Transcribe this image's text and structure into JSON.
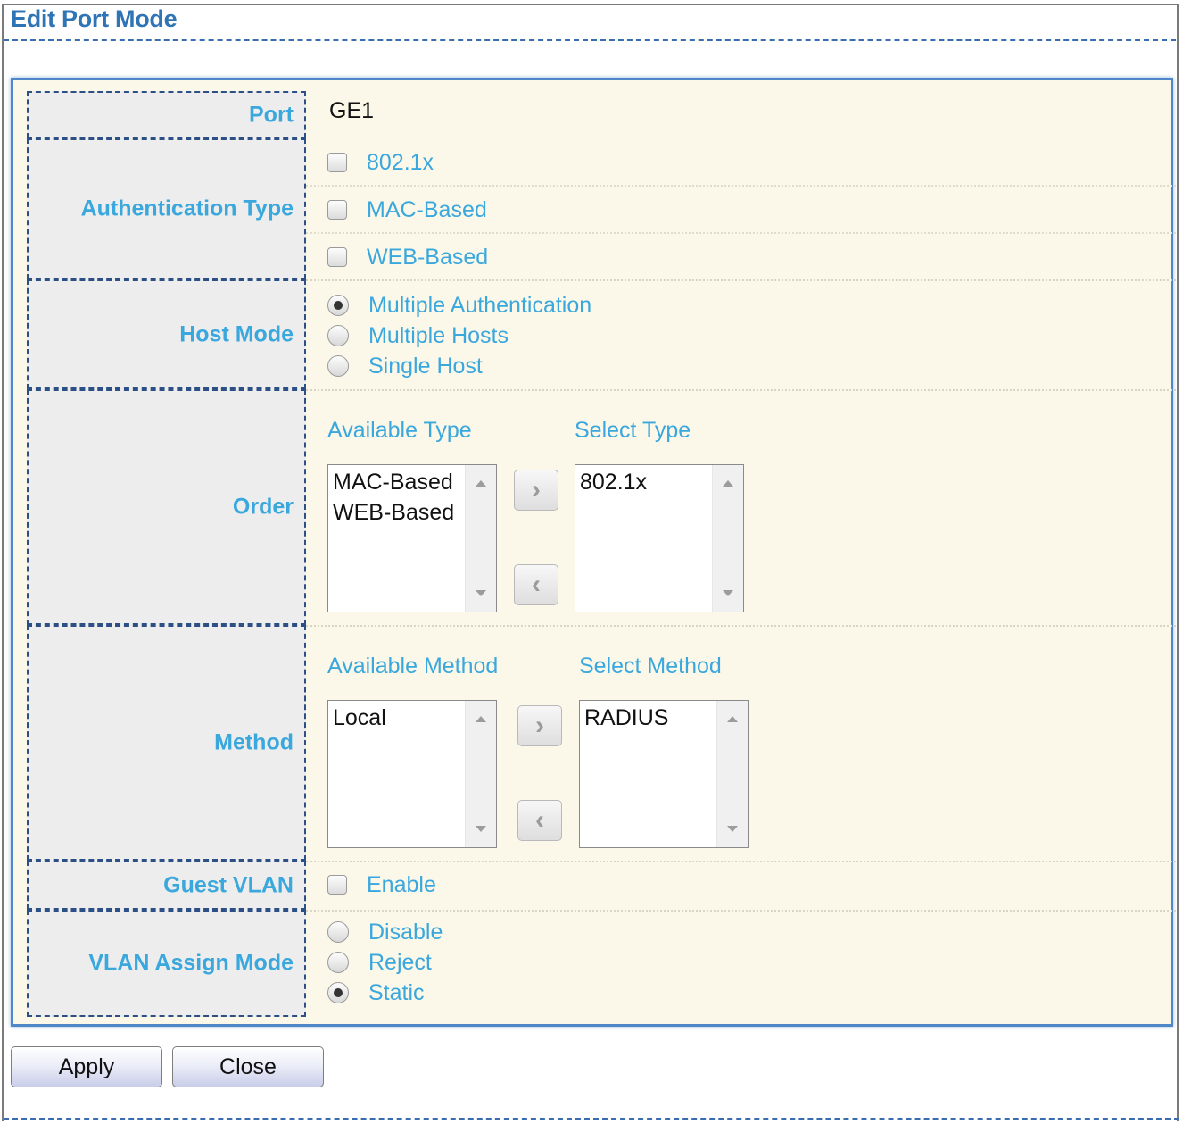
{
  "dialog": {
    "title": "Edit Port Mode"
  },
  "port": {
    "label": "Port",
    "value": "GE1"
  },
  "auth_type": {
    "label": "Authentication Type",
    "options": [
      {
        "label": "802.1x",
        "checked": false
      },
      {
        "label": "MAC-Based",
        "checked": false
      },
      {
        "label": "WEB-Based",
        "checked": false
      }
    ]
  },
  "host_mode": {
    "label": "Host Mode",
    "options": [
      {
        "label": "Multiple Authentication",
        "selected": true
      },
      {
        "label": "Multiple Hosts",
        "selected": false
      },
      {
        "label": "Single Host",
        "selected": false
      }
    ]
  },
  "order": {
    "label": "Order",
    "available_header": "Available Type",
    "selected_header": "Select Type",
    "available_items": [
      "MAC-Based",
      "WEB-Based"
    ],
    "selected_items": [
      "802.1x"
    ]
  },
  "method": {
    "label": "Method",
    "available_header": "Available Method",
    "selected_header": "Select Method",
    "available_items": [
      "Local"
    ],
    "selected_items": [
      "RADIUS"
    ]
  },
  "guest_vlan": {
    "label": "Guest VLAN",
    "option": {
      "label": "Enable",
      "checked": false
    }
  },
  "vlan_assign_mode": {
    "label": "VLAN Assign Mode",
    "options": [
      {
        "label": "Disable",
        "selected": false
      },
      {
        "label": "Reject",
        "selected": false
      },
      {
        "label": "Static",
        "selected": true
      }
    ]
  },
  "buttons": {
    "apply": "Apply",
    "close": "Close"
  },
  "icons": {
    "move_right": "chevron-right-icon",
    "move_left": "chevron-left-icon"
  },
  "colors": {
    "label": "#3aa7dd",
    "title": "#2f74b5",
    "panel_bg": "#fbf8e9",
    "label_bg": "#ededed"
  }
}
